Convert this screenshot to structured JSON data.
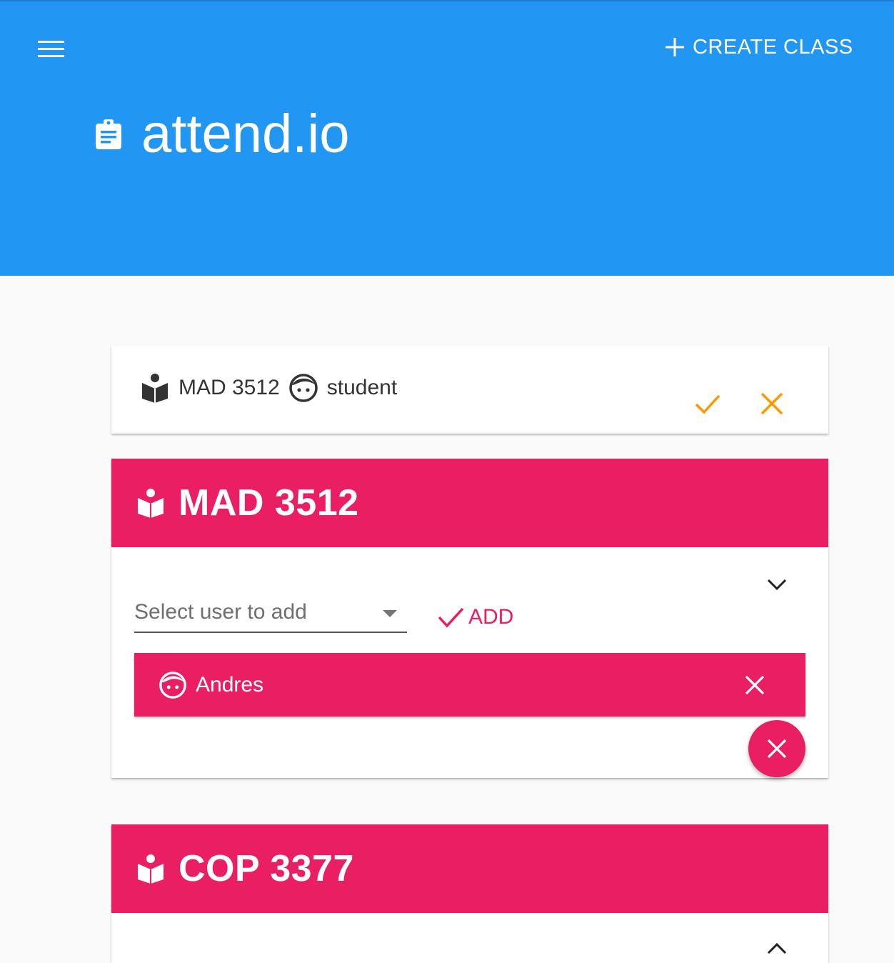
{
  "header": {
    "create_label": "CREATE CLASS",
    "title": "attend.io",
    "bg_color": "#2196f3"
  },
  "invite": {
    "class_name": "MAD 3512",
    "role": "student",
    "accent_color": "#ff9800"
  },
  "classes": [
    {
      "title": "MAD 3512",
      "expanded": true,
      "select_placeholder": "Select user to add",
      "add_label": "ADD",
      "members": [
        {
          "name": "Andres"
        }
      ]
    },
    {
      "title": "COP 3377",
      "expanded": false
    }
  ],
  "colors": {
    "primary": "#e91e63",
    "blue": "#2196f3"
  }
}
